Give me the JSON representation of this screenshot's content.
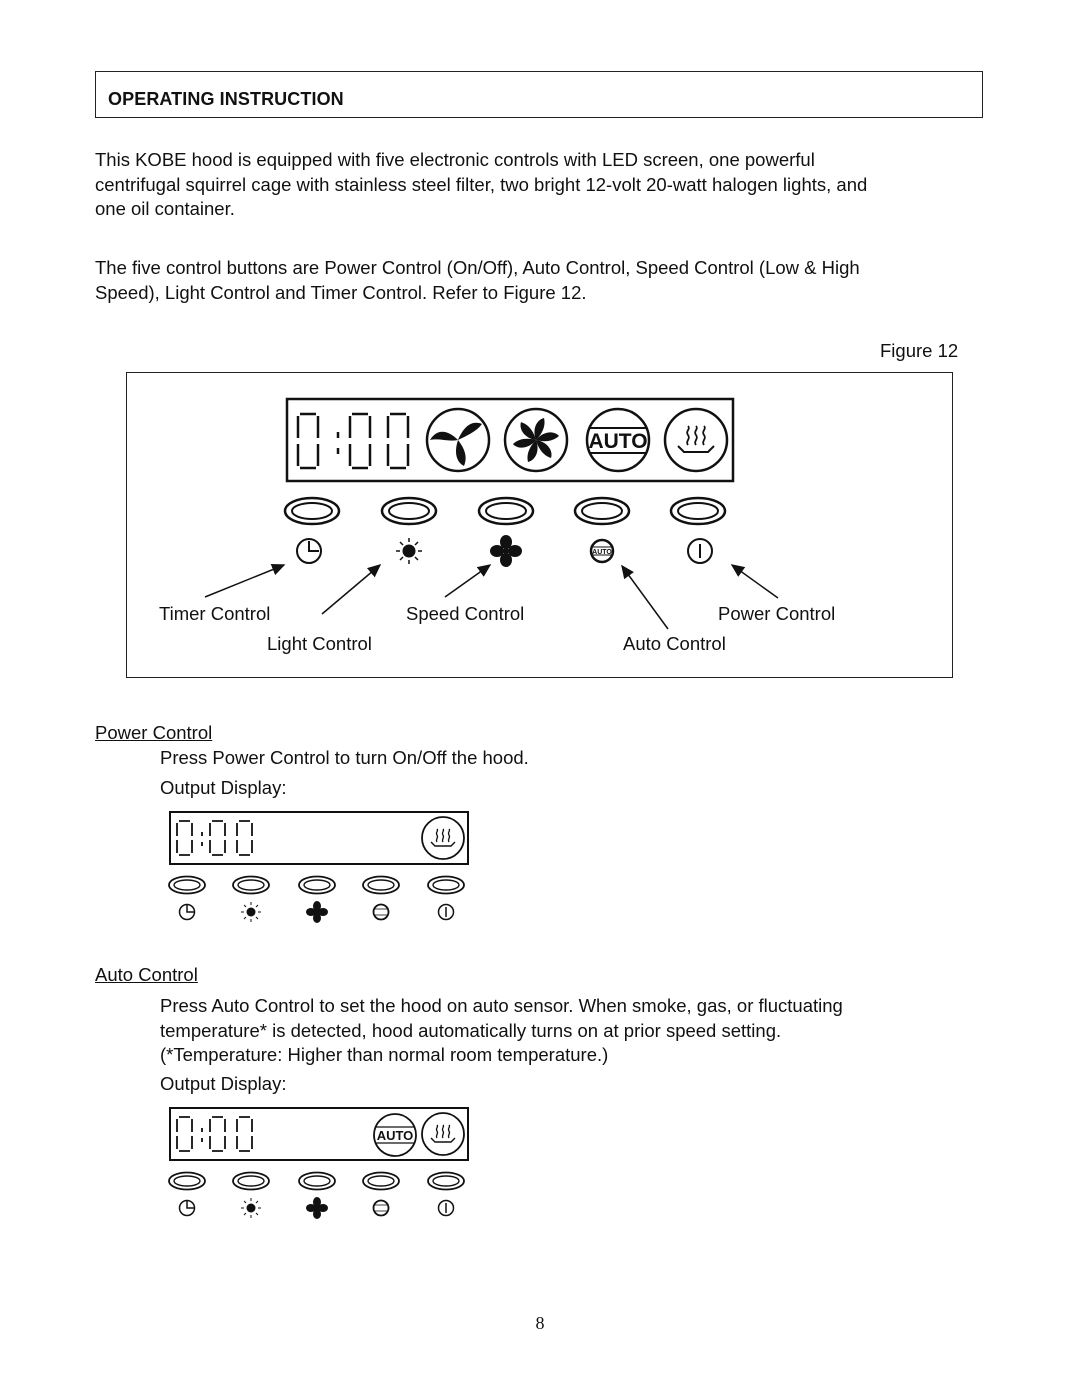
{
  "header": {
    "title": "OPERATING INSTRUCTION"
  },
  "intro": {
    "paragraph1_lines": [
      "This KOBE hood is equipped with five electronic controls with LED screen, one powerful",
      "centrifugal squirrel cage with stainless steel filter, two bright 12-volt 20-watt halogen lights, and",
      "one oil container."
    ],
    "paragraph2_lines": [
      "The five control buttons are Power Control (On/Off), Auto Control, Speed Control (Low & High",
      "Speed), Light Control and Timer Control. Refer to Figure 12."
    ]
  },
  "figure": {
    "label": "Figure 12",
    "display_time": "0:00",
    "display_icons": [
      "low-speed-fan-icon",
      "high-speed-fan-icon",
      "auto-icon",
      "heat-sensor-icon"
    ],
    "auto_badge": "AUTO",
    "buttons": [
      {
        "icon": "timer-icon",
        "label": "Timer Control"
      },
      {
        "icon": "light-icon",
        "label": "Light Control"
      },
      {
        "icon": "fan-icon",
        "label": "Speed Control"
      },
      {
        "icon": "auto-icon",
        "label": "Auto Control",
        "badge": "AUTO"
      },
      {
        "icon": "power-icon",
        "label": "Power Control"
      }
    ]
  },
  "sections": [
    {
      "title": "Power Control",
      "lines": [
        "Press Power Control to turn On/Off the hood."
      ],
      "output_label": "Output Display:",
      "display_time": "0:00",
      "display_icons": [
        "heat-sensor-icon"
      ]
    },
    {
      "title": "Auto Control",
      "lines": [
        "Press Auto Control to set the hood on auto sensor.  When smoke, gas, or fluctuating",
        "temperature* is detected, hood automatically turns on at prior speed setting.",
        "(*Temperature: Higher than normal room temperature.)"
      ],
      "output_label": "Output Display:",
      "display_time": "0:00",
      "display_icons": [
        "auto-icon",
        "heat-sensor-icon"
      ],
      "auto_badge": "AUTO"
    }
  ],
  "page_number": "8"
}
